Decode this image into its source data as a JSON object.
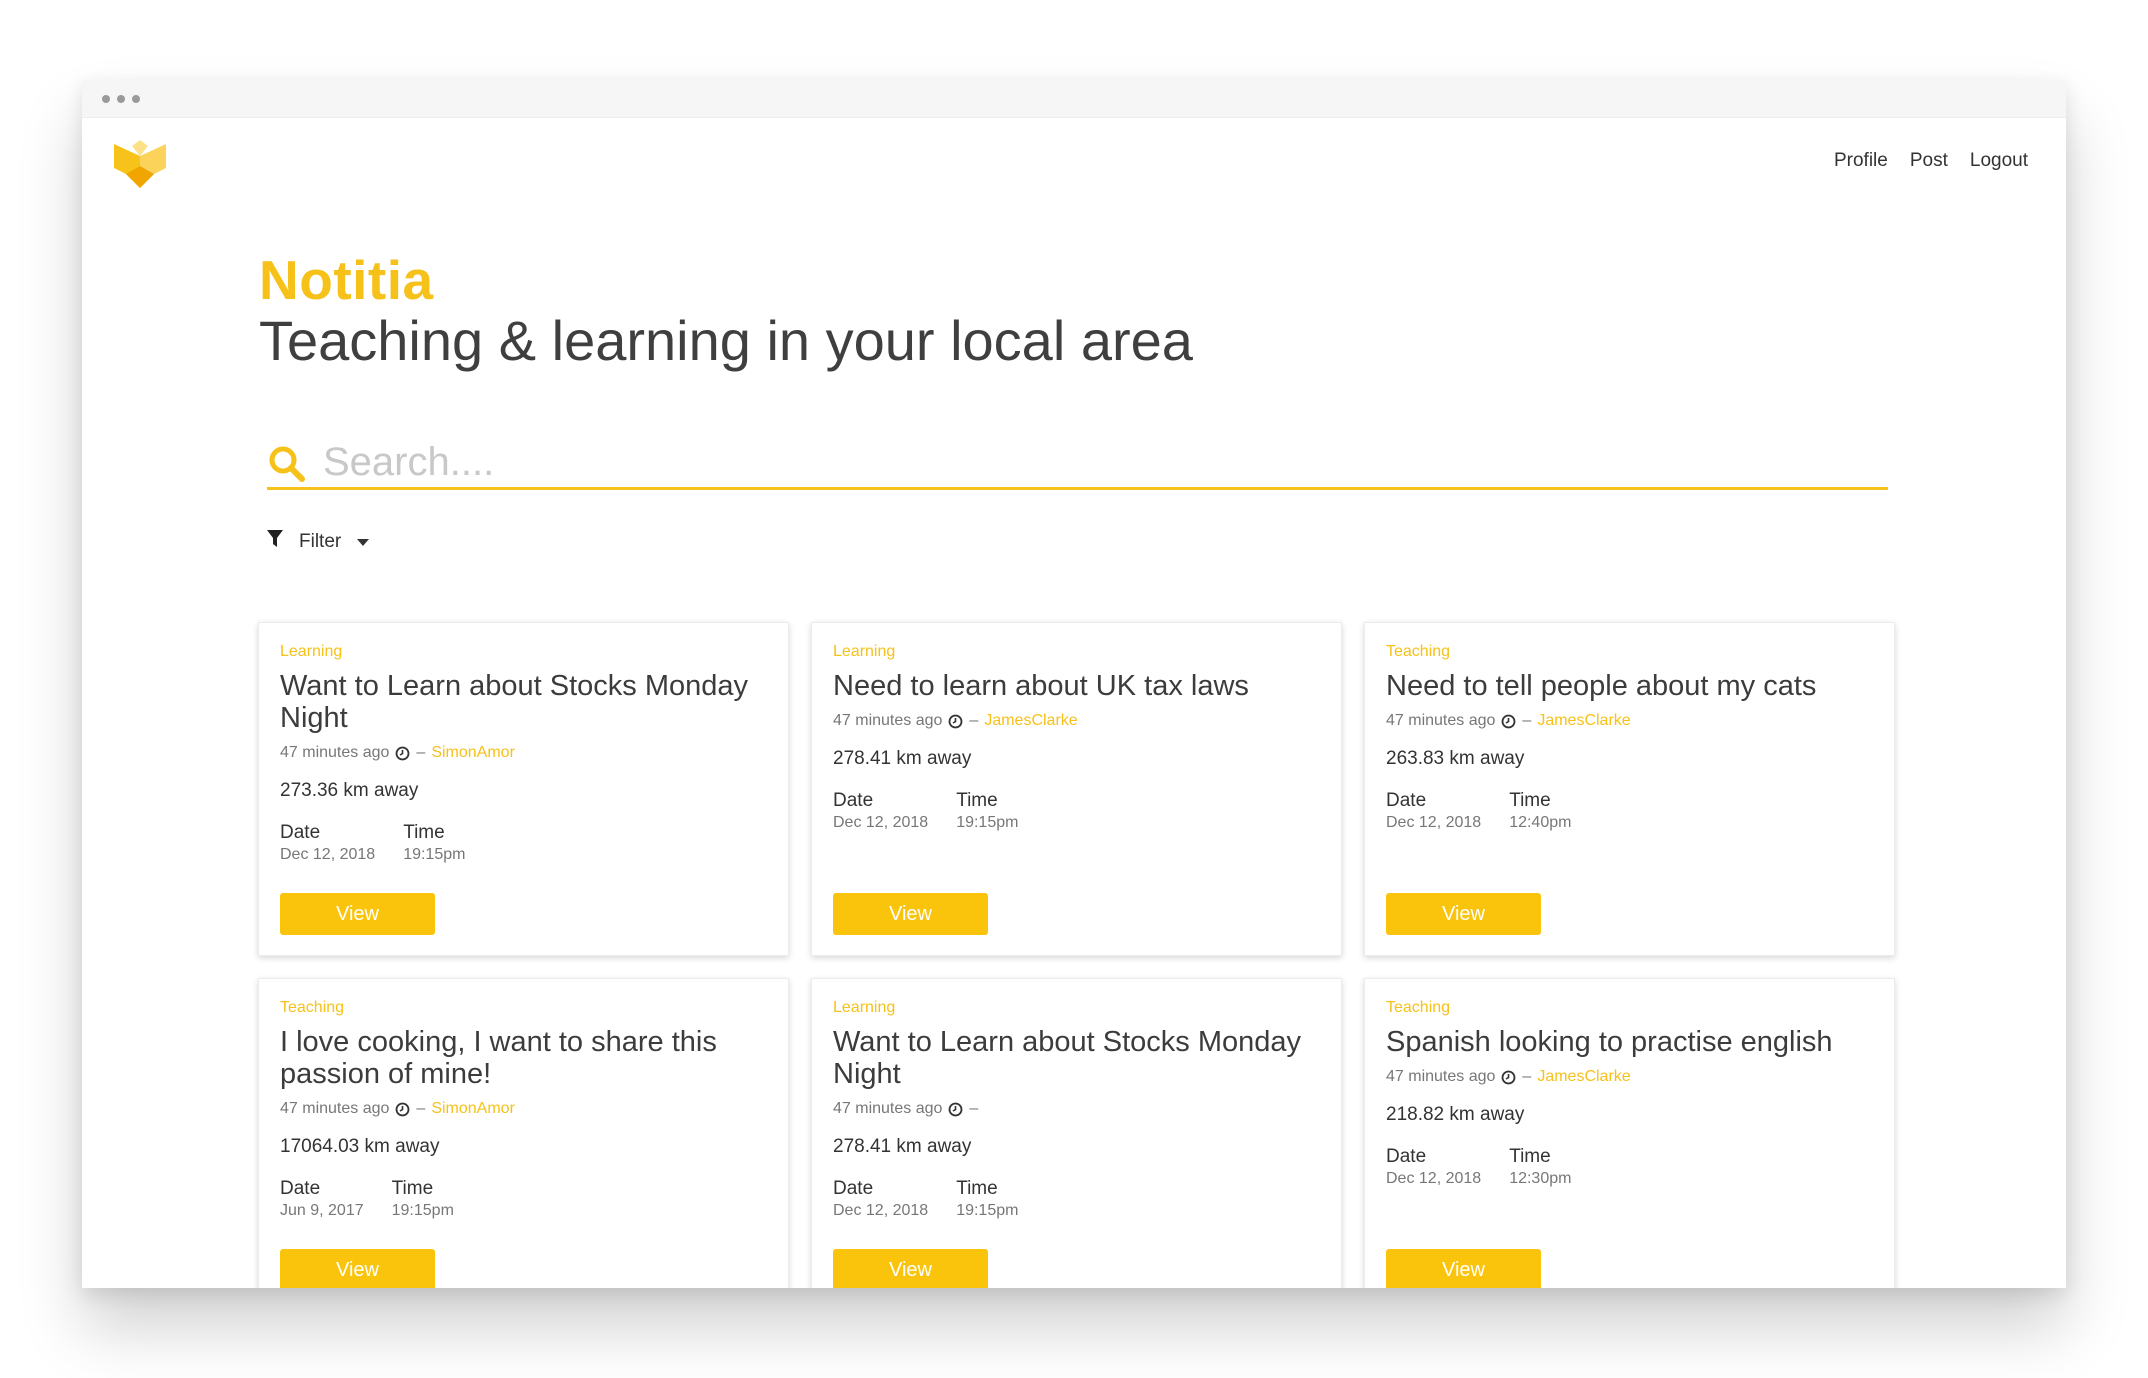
{
  "nav": {
    "items": [
      "Profile",
      "Post",
      "Logout"
    ]
  },
  "hero": {
    "brand": "Notitia",
    "tagline": "Teaching & learning in your local area"
  },
  "search": {
    "placeholder": "Search...."
  },
  "filter": {
    "label": "Filter"
  },
  "icons": {
    "logo": "book-logo-icon",
    "search": "search-icon",
    "filter": "filter-funnel-icon",
    "dropdown": "chevron-down-icon",
    "clock": "clock-icon"
  },
  "colors": {
    "accent": "#f6c118",
    "button": "#fbc40c",
    "text": "#3c3c3c",
    "muted": "#777777"
  },
  "cards": [
    {
      "tag": "Learning",
      "title": "Want to Learn about Stocks Monday Night",
      "time_ago": "47 minutes ago",
      "separator": "–",
      "author": "SimonAmor",
      "distance": "273.36 km away",
      "date_label": "Date",
      "date": "Dec 12, 2018",
      "time_label": "Time",
      "time": "19:15pm",
      "button": "View"
    },
    {
      "tag": "Learning",
      "title": "Need to learn about UK tax laws",
      "time_ago": "47 minutes ago",
      "separator": "–",
      "author": "JamesClarke",
      "distance": "278.41 km away",
      "date_label": "Date",
      "date": "Dec 12, 2018",
      "time_label": "Time",
      "time": "19:15pm",
      "button": "View"
    },
    {
      "tag": "Teaching",
      "title": "Need to tell people about my cats",
      "time_ago": "47 minutes ago",
      "separator": "–",
      "author": "JamesClarke",
      "distance": "263.83 km away",
      "date_label": "Date",
      "date": "Dec 12, 2018",
      "time_label": "Time",
      "time": "12:40pm",
      "button": "View"
    },
    {
      "tag": "Teaching",
      "title": "I love cooking, I want to share this passion of mine!",
      "time_ago": "47 minutes ago",
      "separator": "–",
      "author": "SimonAmor",
      "distance": "17064.03 km away",
      "date_label": "Date",
      "date": "Jun 9, 2017",
      "time_label": "Time",
      "time": "19:15pm",
      "button": "View"
    },
    {
      "tag": "Learning",
      "title": "Want to Learn about Stocks Monday Night",
      "time_ago": "47 minutes ago",
      "separator": "–",
      "author": "",
      "distance": "278.41 km away",
      "date_label": "Date",
      "date": "Dec 12, 2018",
      "time_label": "Time",
      "time": "19:15pm",
      "button": "View"
    },
    {
      "tag": "Teaching",
      "title": "Spanish looking to practise english",
      "time_ago": "47 minutes ago",
      "separator": "–",
      "author": "JamesClarke",
      "distance": "218.82 km away",
      "date_label": "Date",
      "date": "Dec 12, 2018",
      "time_label": "Time",
      "time": "12:30pm",
      "button": "View"
    }
  ]
}
